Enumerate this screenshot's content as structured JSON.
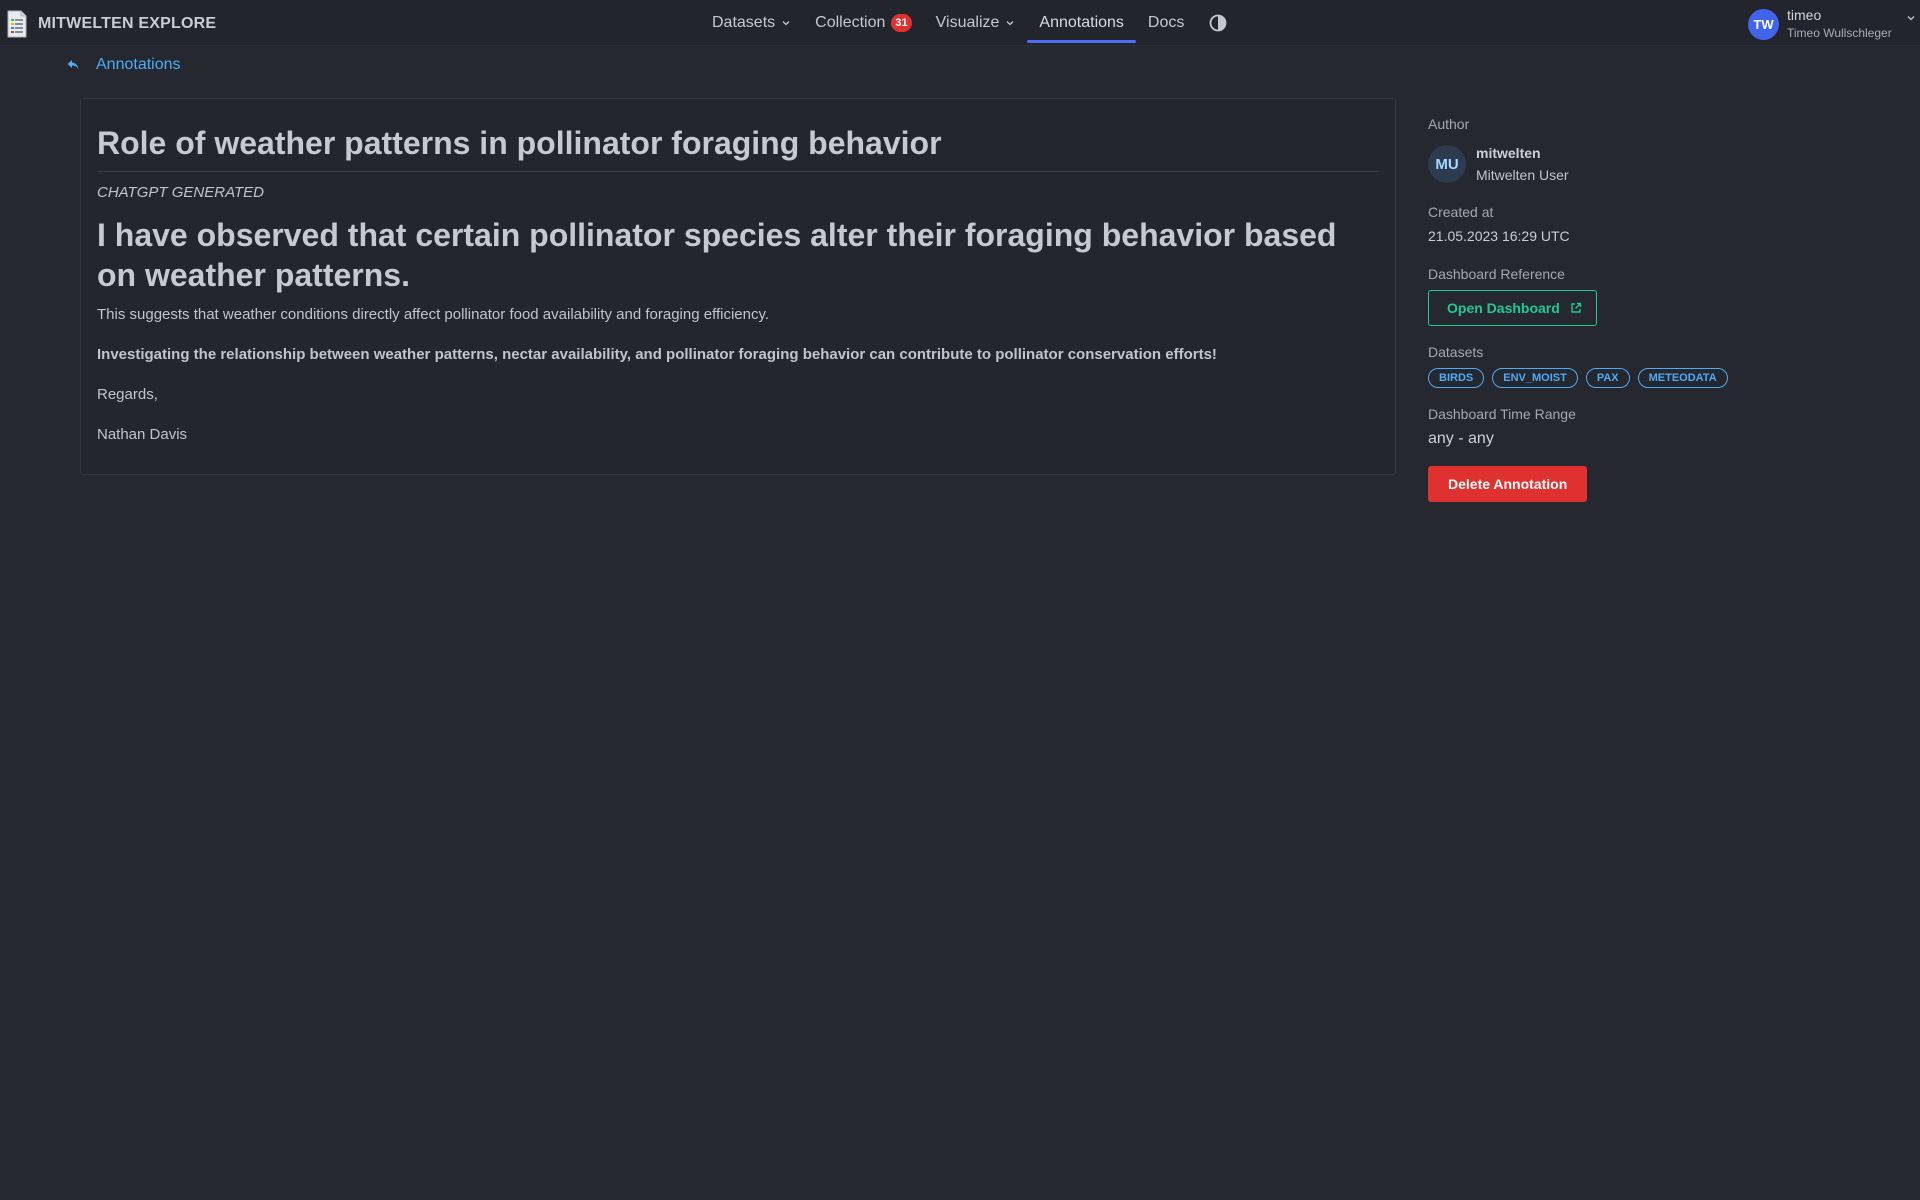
{
  "app": {
    "brand": "MITWELTEN EXPLORE",
    "brand_icon": "document-icon"
  },
  "nav": {
    "items": [
      {
        "label": "Datasets",
        "dropdown": true
      },
      {
        "label": "Collection",
        "badge": "31"
      },
      {
        "label": "Visualize",
        "dropdown": true
      },
      {
        "label": "Annotations",
        "active": true
      },
      {
        "label": "Docs"
      }
    ],
    "theme_toggle_icon": "contrast-icon"
  },
  "user": {
    "initials": "TW",
    "login": "timeo",
    "full_name": "Timeo Wullschleger"
  },
  "breadcrumb": {
    "label": "Annotations",
    "icon": "back-arrow-icon"
  },
  "annotation": {
    "title": "Role of weather patterns in pollinator foraging behavior",
    "tag": "CHATGPT GENERATED",
    "lead": "I have observed that certain pollinator species alter their foraging behavior based on weather patterns.",
    "paragraph_1": "This suggests that weather conditions directly affect pollinator food availability and foraging efficiency.",
    "paragraph_2": "Investigating the relationship between weather patterns, nectar availability, and pollinator foraging behavior can contribute to pollinator conservation efforts!",
    "closing": "Regards,",
    "signature": "Nathan Davis"
  },
  "side": {
    "author_label": "Author",
    "author_initials": "MU",
    "author_login": "mitwelten",
    "author_full_name": "Mitwelten User",
    "created_label": "Created at",
    "created_value": "21.05.2023 16:29 UTC",
    "dashboard_label": "Dashboard Reference",
    "open_dashboard": "Open Dashboard",
    "datasets_label": "Datasets",
    "datasets": [
      "BIRDS",
      "ENV_MOIST",
      "PAX",
      "METEODATA"
    ],
    "time_range_label": "Dashboard Time Range",
    "time_range_value": "any - any",
    "delete_button": "Delete Annotation"
  },
  "colors": {
    "background": "#25282e",
    "accent_blue": "#4dabf7",
    "accent_teal": "#20c997",
    "danger": "#e03131",
    "nav_indicator": "#4c6ef5"
  }
}
